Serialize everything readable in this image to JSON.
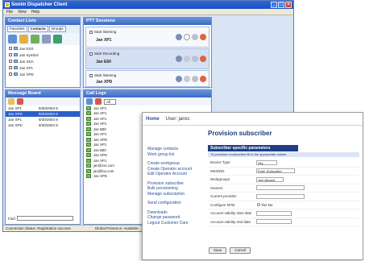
{
  "app": {
    "title": "Sonim Dispatcher Client"
  },
  "menu": [
    "File",
    "View",
    "Help"
  ],
  "contacts": {
    "header": "Contact Lists",
    "tabs": [
      "Favorites",
      "Contacts",
      "Groups"
    ],
    "items": [
      "Jan ESS",
      "Jan Symbol",
      "Jan XDA",
      "Jan XP1",
      "Jan XPD"
    ]
  },
  "sessions": {
    "header": "PTT Sessions",
    "items": [
      {
        "label": "Start listening",
        "name": "Jan XP1"
      },
      {
        "label": "Start Recording",
        "name": "Jan E60"
      },
      {
        "label": "Start listening",
        "name": "Jan XPD"
      }
    ]
  },
  "messages": {
    "header": "Message Board",
    "rows": [
      {
        "from": "Jan XP1",
        "date": "9/30/2004 9"
      },
      {
        "from": "Jan XPD",
        "date": "9/30/2004 9"
      },
      {
        "from": "Jan XP1",
        "date": "9/30/2004 9"
      },
      {
        "from": "Jan XPD",
        "date": "9/30/2004 9"
      }
    ],
    "find_label": "Find"
  },
  "calls": {
    "header": "Call Logs",
    "filter": "All",
    "rows": [
      "Jan XP1",
      "Jan XP1",
      "Jan XP1",
      "Jan XP1",
      "Jan B80",
      "Jan XP1",
      "Jan XPD",
      "Jan XP1",
      "Jan B80",
      "Jan XPD",
      "Jan XP1",
      "jan@zxs.com",
      "jan@foo.com",
      "Jan XPD"
    ]
  },
  "status": {
    "connection": "Connection Status: Registration success",
    "presence": "Global Presence: Available"
  },
  "web": {
    "home": "Home",
    "user": "User: janxc",
    "page_title": "Provision subscriber",
    "section": "Subscriber specific parameters",
    "subtext": "To provision a subscriber fill in the appropriate values",
    "nav": [
      "Manage contacts",
      "Work group list",
      "",
      "Create workgroup",
      "Create Operator account",
      "Edit Operator Account",
      "",
      "Provision subscriber",
      "Bulk provisioning",
      "Manage subscription",
      "",
      "Send configuration",
      "",
      "Downloads",
      "Change password",
      "Logout Customer Care"
    ],
    "fields": [
      {
        "label": "Device Type",
        "value": "Sky"
      },
      {
        "label": "MSISDN",
        "value": "Enter Subscriber"
      },
      {
        "label": "Workgroups",
        "value": "Join Aboard"
      },
      {
        "label": "Owners",
        "value": ""
      },
      {
        "label": "Current provider",
        "value": ""
      },
      {
        "label": "Configure MTB",
        "value": "Yes  No"
      },
      {
        "label": "Account validity start date",
        "value": ""
      },
      {
        "label": "Account validity end date",
        "value": ""
      }
    ],
    "save": "Save",
    "cancel": "Cancel"
  }
}
